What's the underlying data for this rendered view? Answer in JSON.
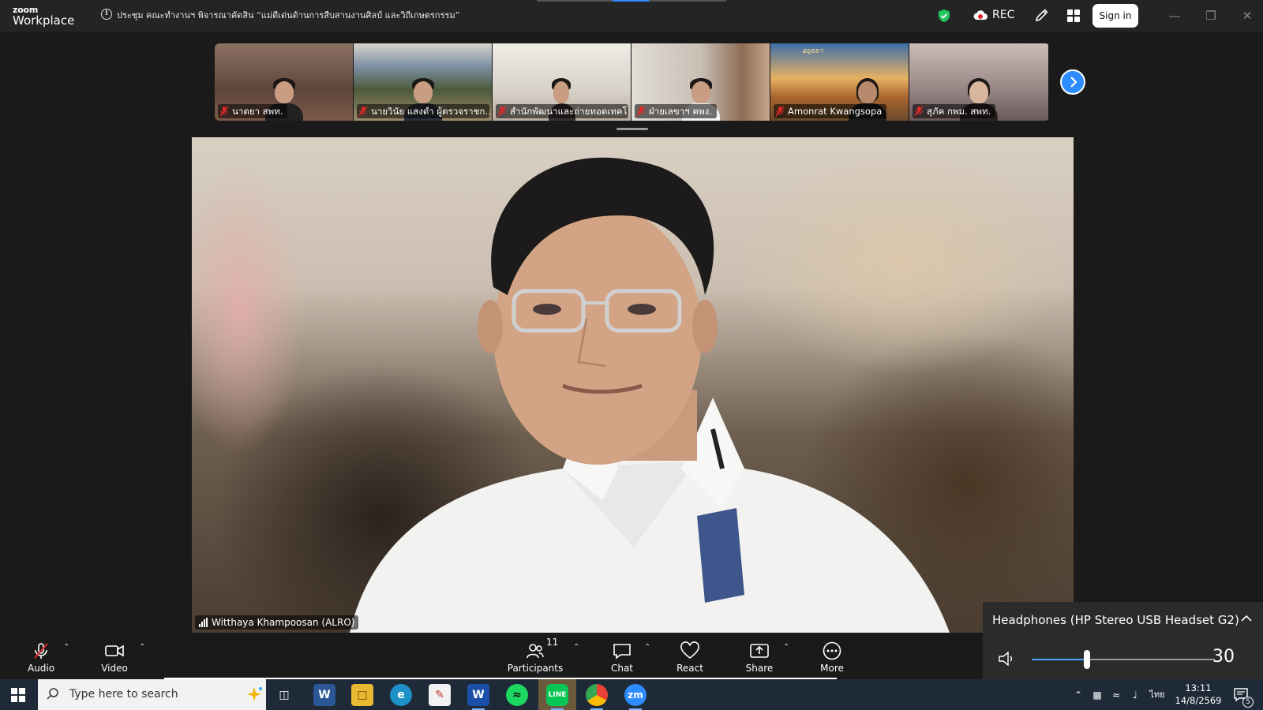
{
  "app": {
    "logo_line1": "zoom",
    "logo_line2": "Workplace",
    "meeting_title": "ประชุม คณะทำงานฯ พิจารณาคัดสิน “แม่ดีเด่นด้านการสืบสานงานศิลป์ และวิถีเกษตรกรรม”",
    "rec_label": "REC",
    "signin_label": "Sign in"
  },
  "thumbnails": [
    {
      "name": "นาตยา สพท.",
      "bg": "#8a6d5e"
    },
    {
      "name": "นายวินัย แสงดำ ผู้ตรวจราชก...",
      "bg": "#6a7c8e"
    },
    {
      "name": "สำนักพัฒนาและถ่ายทอดเทคโ...",
      "bg": "#c9c2b8"
    },
    {
      "name": "ฝ่ายเลขาฯ คพง.",
      "bg": "#b3a59a"
    },
    {
      "name": "Amonrat Kwangsopa",
      "bg": "#c08850"
    },
    {
      "name": "สุภัค กพม. สพท.",
      "bg": "#b7a6a4"
    }
  ],
  "thumbnail_banner_text": "อยุธยา",
  "main_video": {
    "speaker_name": "Witthaya Khampoosan (ALRO)"
  },
  "toolbar": {
    "audio_label": "Audio",
    "video_label": "Video",
    "participants_label": "Participants",
    "participants_count": "11",
    "chat_label": "Chat",
    "react_label": "React",
    "share_label": "Share",
    "more_label": "More"
  },
  "volume_flyout": {
    "device": "Headphones (HP Stereo USB Headset G2)",
    "level": 30
  },
  "taskbar": {
    "search_placeholder": "Type here to search",
    "language": "ไทย",
    "time": "13:11",
    "date": "14/8/2569",
    "notification_count": "5"
  },
  "colors": {
    "accent": "#2d8cff",
    "titlebar": "#242424",
    "background": "#1a1a1a",
    "taskbar": "#1f2a38",
    "shield": "#23c45e",
    "mute_red": "#e02828"
  }
}
